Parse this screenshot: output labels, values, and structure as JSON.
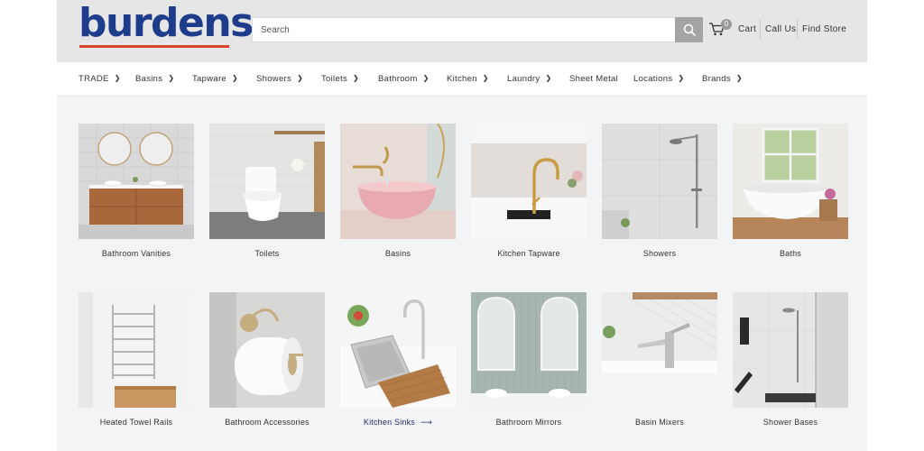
{
  "brand": {
    "name": "burdens",
    "color": "#1e3c8c",
    "accent": "#d9432c"
  },
  "search": {
    "placeholder": "Search"
  },
  "header": {
    "cart_count": "0",
    "cart_label": "Cart",
    "call_us": "Call Us",
    "find_store": "Find Store"
  },
  "nav": {
    "items": [
      {
        "label": "TRADE",
        "dropdown": true
      },
      {
        "label": "Basins",
        "dropdown": true
      },
      {
        "label": "Tapware",
        "dropdown": true
      },
      {
        "label": "Showers",
        "dropdown": true
      },
      {
        "label": "Toilets",
        "dropdown": true
      },
      {
        "label": "Bathroom",
        "dropdown": true
      },
      {
        "label": "Kitchen",
        "dropdown": true
      },
      {
        "label": "Laundry",
        "dropdown": true
      },
      {
        "label": "Sheet Metal",
        "dropdown": false
      },
      {
        "label": "Locations",
        "dropdown": true
      },
      {
        "label": "Brands",
        "dropdown": true
      }
    ]
  },
  "categories": [
    {
      "label": "Bathroom Vanities"
    },
    {
      "label": "Toilets"
    },
    {
      "label": "Basins"
    },
    {
      "label": "Kitchen Tapware"
    },
    {
      "label": "Showers"
    },
    {
      "label": "Baths"
    },
    {
      "label": "Heated Towel Rails"
    },
    {
      "label": "Bathroom Accessories"
    },
    {
      "label": "Kitchen Sinks",
      "active": true
    },
    {
      "label": "Bathroom Mirrors"
    },
    {
      "label": "Basin Mixers"
    },
    {
      "label": "Shower Bases"
    }
  ]
}
